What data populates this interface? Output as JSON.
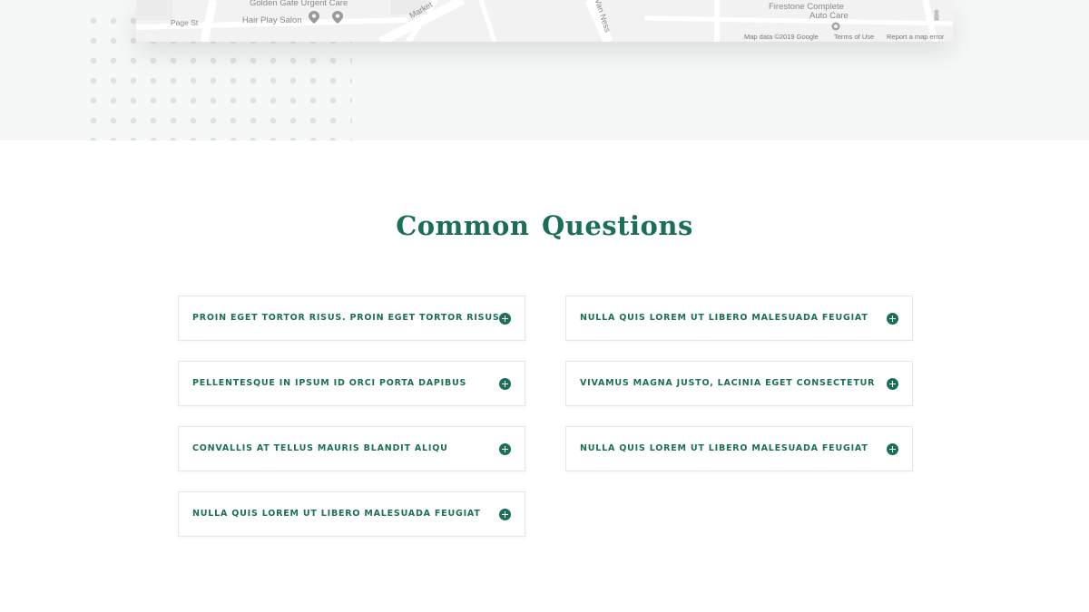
{
  "map": {
    "labels": {
      "urgent_care": "Golden Gate Urgent Care",
      "page_st": "Page St",
      "salon": "Hair Play Salon",
      "market": "Market",
      "van_ness": "Van Ness",
      "firestone": "Firestone Complete",
      "auto_care": "Auto Care"
    },
    "footer": {
      "data": "Map data ©2019 Google",
      "terms": "Terms of Use",
      "report": "Report a map error"
    }
  },
  "faq_section": {
    "title": "Common Questions",
    "accent_color": "#1b6e57",
    "left_column": [
      {
        "question": "PROIN EGET TORTOR RISUS. PROIN EGET TORTOR RISUS"
      },
      {
        "question": "PELLENTESQUE IN IPSUM ID ORCI PORTA DAPIBUS"
      },
      {
        "question": "CONVALLIS AT TELLUS MAURIS BLANDIT ALIQU"
      },
      {
        "question": "NULLA QUIS LOREM UT LIBERO MALESUADA FEUGIAT"
      }
    ],
    "right_column": [
      {
        "question": "NULLA QUIS LOREM UT LIBERO MALESUADA FEUGIAT"
      },
      {
        "question": "VIVAMUS MAGNA JUSTO, LACINIA EGET CONSECTETUR"
      },
      {
        "question": "NULLA QUIS LOREM UT LIBERO MALESUADA FEUGIAT"
      }
    ]
  }
}
